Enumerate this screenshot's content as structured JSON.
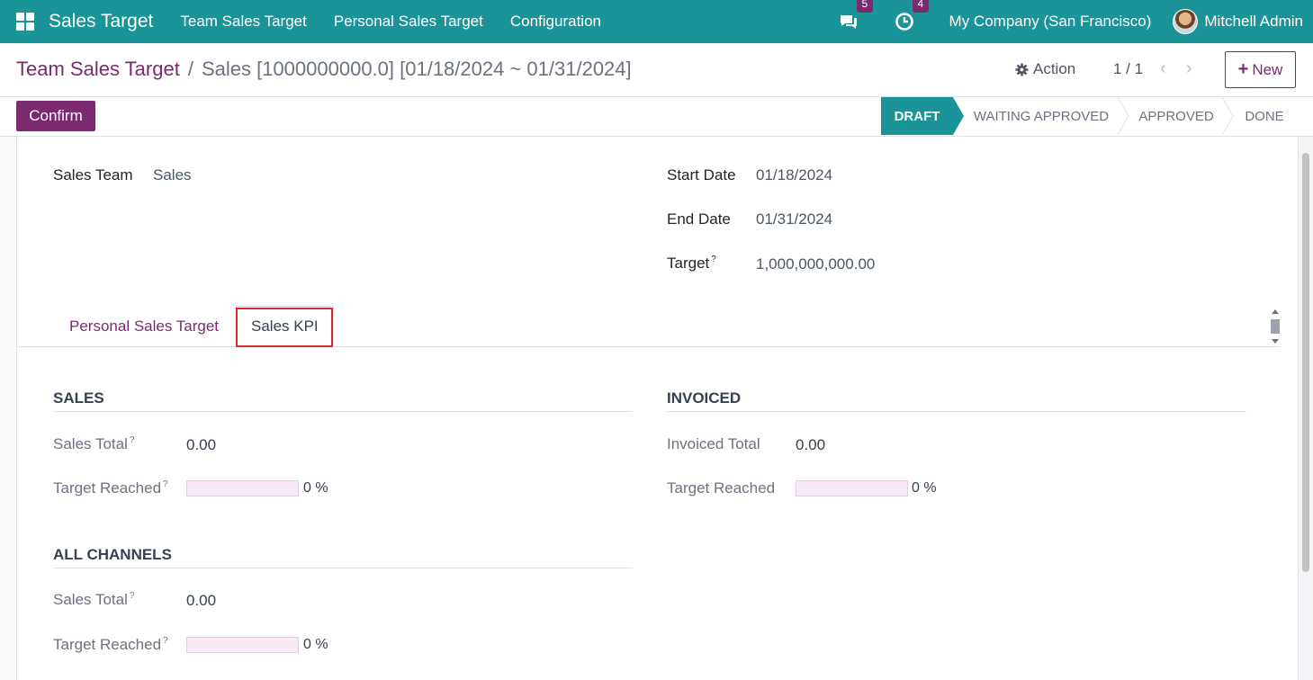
{
  "navbar": {
    "app_title": "Sales Target",
    "menu": [
      "Team Sales Target",
      "Personal Sales Target",
      "Configuration"
    ],
    "messages_count": "5",
    "activities_count": "4",
    "company": "My Company (San Francisco)",
    "user": "Mitchell Admin"
  },
  "control_panel": {
    "breadcrumb_parent": "Team Sales Target",
    "breadcrumb_separator": "/",
    "breadcrumb_current": "Sales [1000000000.0] [01/18/2024 ~ 01/31/2024]",
    "action_label": "Action",
    "pager": "1 / 1",
    "new_label": "New"
  },
  "statusbar": {
    "confirm_label": "Confirm",
    "stages": [
      "DRAFT",
      "WAITING APPROVED",
      "APPROVED",
      "DONE"
    ],
    "active_stage": "DRAFT"
  },
  "form": {
    "sales_team_label": "Sales Team",
    "sales_team_value": "Sales",
    "start_date_label": "Start Date",
    "start_date_value": "01/18/2024",
    "end_date_label": "End Date",
    "end_date_value": "01/31/2024",
    "target_label": "Target",
    "target_value": "1,000,000,000.00",
    "help_mark": "?"
  },
  "tabs": {
    "personal": "Personal Sales Target",
    "kpi": "Sales KPI",
    "active": "Sales KPI"
  },
  "kpi": {
    "sales": {
      "title": "SALES",
      "total_label": "Sales Total",
      "total_value": "0.00",
      "reached_label": "Target Reached",
      "reached_value": "0 %",
      "reached_fraction": 0
    },
    "invoiced": {
      "title": "INVOICED",
      "total_label": "Invoiced Total",
      "total_value": "0.00",
      "reached_label": "Target Reached",
      "reached_value": "0 %",
      "reached_fraction": 0
    },
    "all_channels": {
      "title": "ALL CHANNELS",
      "total_label": "Sales Total",
      "total_value": "0.00",
      "reached_label": "Target Reached",
      "reached_value": "0 %",
      "reached_fraction": 0
    }
  },
  "colors": {
    "brand_teal": "#1a9499",
    "accent_purple": "#7b2a70",
    "highlight_red": "#d62b2b"
  }
}
